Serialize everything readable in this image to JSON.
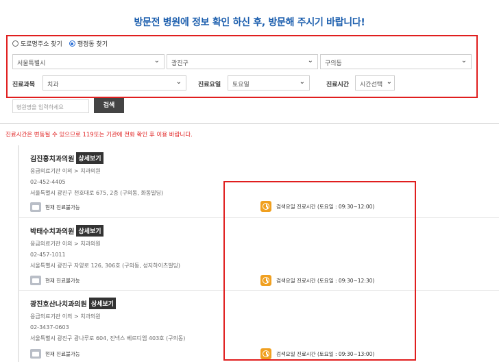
{
  "header": {
    "title": "방문전 병원에 정보 확인 하신 후, 방문해 주시기 바랍니다!"
  },
  "search": {
    "radio_road": "도로명주소 찾기",
    "radio_admin": "행정동 찾기",
    "selected_radio": "행정동 찾기",
    "city": "서울특별시",
    "district": "광진구",
    "dong": "구의동",
    "dept_label": "진료과목",
    "dept_value": "치과",
    "day_label": "진료요일",
    "day_value": "토요일",
    "time_label": "진료시간",
    "time_value": "시간선택",
    "name_placeholder": "병원명을 입력하세요",
    "search_button": "검색"
  },
  "notice": "진료시간은 변동될 수 있으므로 119또는 기관에 전화 확인 후 이용 바랍니다.",
  "results": [
    {
      "name": "김진홍치과의원",
      "detail": "상세보기",
      "type": "응급의료기관 이외 > 치과의원",
      "phone": "02-452-4405",
      "address": "서울특별시 광진구 천호대로 675, 2층 (구의동, 화동빌딩)",
      "status": "현재 진료불가능",
      "hours": "검색요일 진료시간 (토요일 : 09:30~12:00)"
    },
    {
      "name": "박태수치과의원",
      "detail": "상세보기",
      "type": "응급의료기관 이외 > 치과의원",
      "phone": "02-457-1011",
      "address": "서울특별시 광진구 자양로 126, 306호 (구의동, 성지하이츠빌딩)",
      "status": "현재 진료불가능",
      "hours": "검색요일 진료시간 (토요일 : 09:30~12:30)"
    },
    {
      "name": "광진호산나치과의원",
      "detail": "상세보기",
      "type": "응급의료기관 이외 > 치과의원",
      "phone": "02-3437-0603",
      "address": "서울특별시 광진구 광나루로 604, 진넥스 베르디엠 403호 (구의동)",
      "status": "현재 진료불가능",
      "hours": "검색요일 진료시간 (토요일 : 09:30~13:00)"
    }
  ],
  "colors": {
    "title_blue": "#1d5fae",
    "highlight_red": "#e01e1e",
    "clock_orange": "#f0a020"
  }
}
